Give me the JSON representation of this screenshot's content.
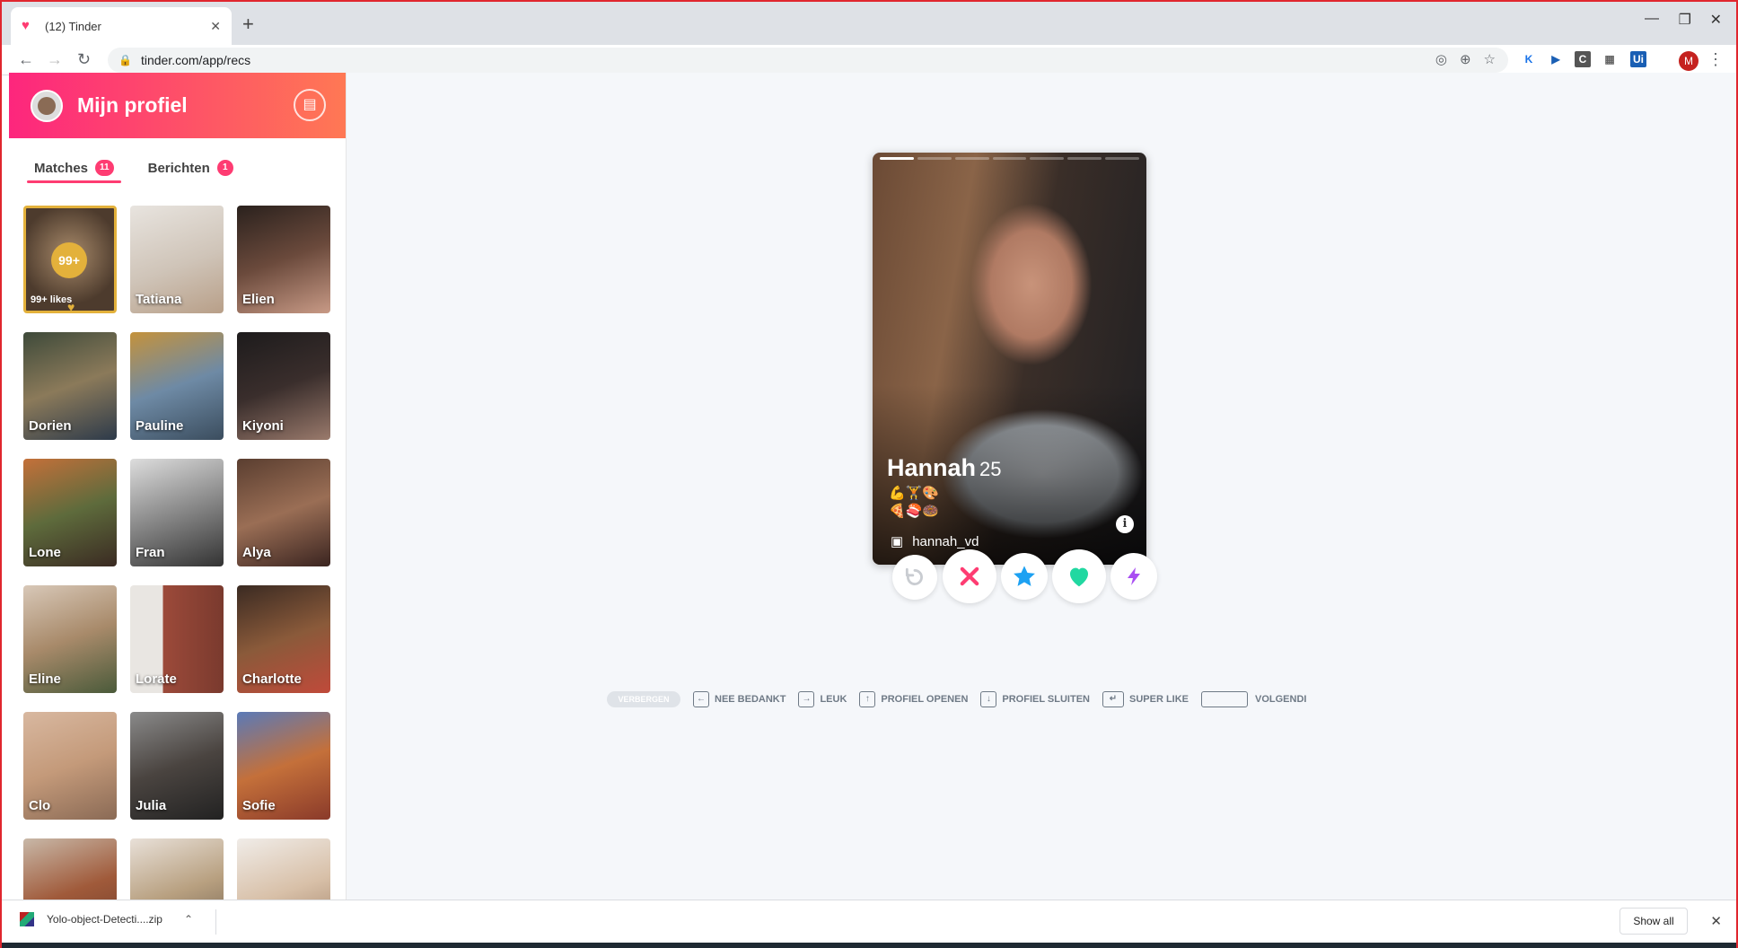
{
  "browser": {
    "tab_title": "(12) Tinder",
    "url": "tinder.com/app/recs",
    "new_tab": "+",
    "profile_initial": "M"
  },
  "sidebar": {
    "title": "Mijn profiel",
    "tabs": [
      {
        "label": "Matches",
        "count": "11"
      },
      {
        "label": "Berichten",
        "count": "1"
      }
    ],
    "likes": {
      "count": "99+",
      "label": "99+ likes"
    },
    "matches": [
      "Tatiana",
      "Elien",
      "Dorien",
      "Pauline",
      "Kiyoni",
      "Lone",
      "Fran",
      "Alya",
      "Eline",
      "Lorate",
      "Charlotte",
      "Clo",
      "Julia",
      "Sofie",
      "",
      "",
      ""
    ]
  },
  "card": {
    "name": "Hannah",
    "age": "25",
    "emoji_line1": "💪🏋🎨",
    "emoji_line2": "🍕🍣🍩",
    "instagram": "hannah_vd"
  },
  "shortcuts": {
    "hide": "VERBERGEN",
    "nope": "NEE BEDANKT",
    "like": "LEUK",
    "open": "PROFIEL OPENEN",
    "close": "PROFIEL SLUITEN",
    "superlike": "SUPER LIKE",
    "next": "VOLGENDI"
  },
  "downloads": {
    "file": "Yolo-object-Detecti....zip",
    "show_all": "Show all"
  },
  "colors": {
    "brand_start": "#fd267d",
    "brand_end": "#ff7854",
    "nope": "#fe3c72",
    "superlike": "#1da1f2",
    "like": "#21d8a1",
    "boost": "#a94ef2"
  }
}
